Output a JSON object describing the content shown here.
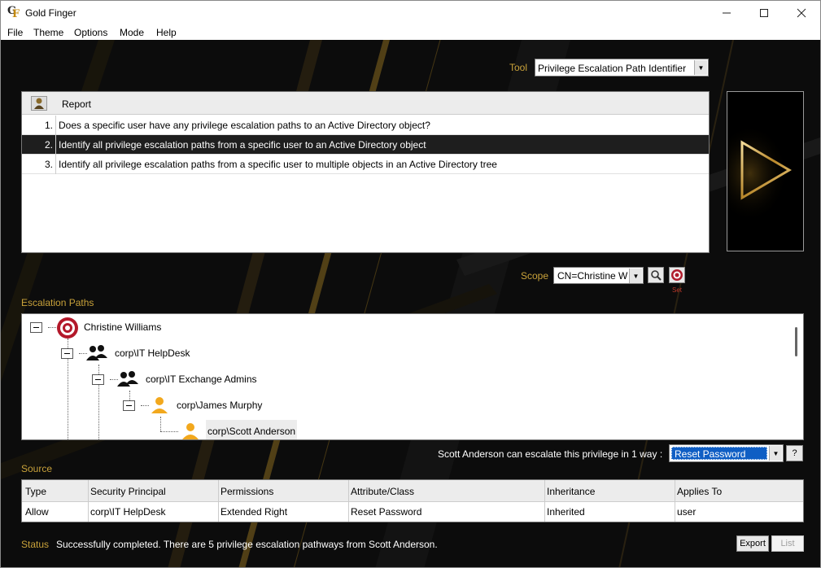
{
  "window": {
    "title": "Gold Finger",
    "icon": "gold-finger-logo",
    "controls": [
      "minimize-icon",
      "maximize-icon",
      "close-icon"
    ]
  },
  "menu": {
    "items": [
      "File",
      "Theme",
      "Options",
      "Mode",
      "Help"
    ]
  },
  "tool": {
    "label": "Tool",
    "value": "Privilege Escalation Path Identifier"
  },
  "report": {
    "header": "Report",
    "rows": [
      {
        "num": "1.",
        "text": "Does a specific user have any privilege escalation paths to an Active Directory object?",
        "selected": false
      },
      {
        "num": "2.",
        "text": "Identify all privilege escalation paths from a specific user to an Active Directory object",
        "selected": true
      },
      {
        "num": "3.",
        "text": "Identify all privilege escalation paths from a specific user to multiple objects in an Active Directory tree",
        "selected": false
      }
    ]
  },
  "scope": {
    "label": "Scope",
    "value": "CN=Christine W",
    "set_label": "Set"
  },
  "escalation": {
    "label": "Escalation Paths",
    "nodes": [
      {
        "label": "Christine Williams",
        "icon": "target-icon"
      },
      {
        "label": "corp\\IT HelpDesk",
        "icon": "group-icon"
      },
      {
        "label": "corp\\IT Exchange Admins",
        "icon": "group-icon"
      },
      {
        "label": "corp\\James Murphy",
        "icon": "user-icon"
      },
      {
        "label": "corp\\Scott Anderson",
        "icon": "user-icon"
      }
    ],
    "summary": "Scott Anderson can escalate this privilege in 1 way :",
    "method": "Reset Password",
    "help": "?"
  },
  "source": {
    "label": "Source",
    "columns": [
      "Type",
      "Security Principal",
      "Permissions",
      "Attribute/Class",
      "Inheritance",
      "Applies To"
    ],
    "rows": [
      [
        "Allow",
        "corp\\IT HelpDesk",
        "Extended Right",
        "Reset Password",
        "Inherited",
        "user"
      ]
    ]
  },
  "status": {
    "label": "Status",
    "text": "Successfully completed. There are 5 privilege escalation pathways from Scott Anderson.",
    "export_label": "Export",
    "list_label": "List"
  },
  "colors": {
    "gold": "#c9a23a",
    "selection": "#1e1e1e",
    "highlight": "#0f5ec4"
  }
}
